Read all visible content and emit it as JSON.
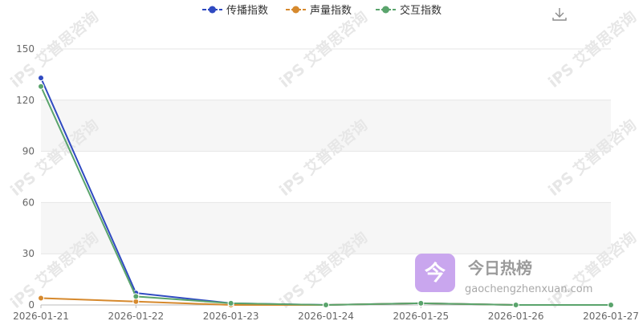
{
  "chart_data": {
    "type": "line",
    "x": [
      "2026-01-21",
      "2026-01-22",
      "2026-01-23",
      "2026-01-24",
      "2026-01-25",
      "2026-01-26",
      "2026-01-27"
    ],
    "ylim": [
      0,
      150
    ],
    "yticks": [
      0,
      30,
      60,
      90,
      120,
      150
    ],
    "grid": true,
    "legend": "top-center",
    "series": [
      {
        "name": "传播指数",
        "color": "#2f4ac1",
        "values": [
          133,
          7,
          1,
          0,
          1,
          0,
          0
        ]
      },
      {
        "name": "声量指数",
        "color": "#d6892d",
        "values": [
          4,
          2,
          0,
          0,
          1,
          0,
          0
        ]
      },
      {
        "name": "交互指数",
        "color": "#5aa46c",
        "values": [
          128,
          5,
          1,
          0,
          1,
          0,
          0
        ]
      }
    ]
  },
  "watermark": {
    "text": "艾普思咨询",
    "logo": "iPS"
  },
  "brand": {
    "name": "今日热榜",
    "url": "gaochengzhenxuan.com",
    "logo_char": "今",
    "logo_color": "#c9a6ee"
  },
  "toolbar": {
    "download_icon": "download-icon"
  }
}
